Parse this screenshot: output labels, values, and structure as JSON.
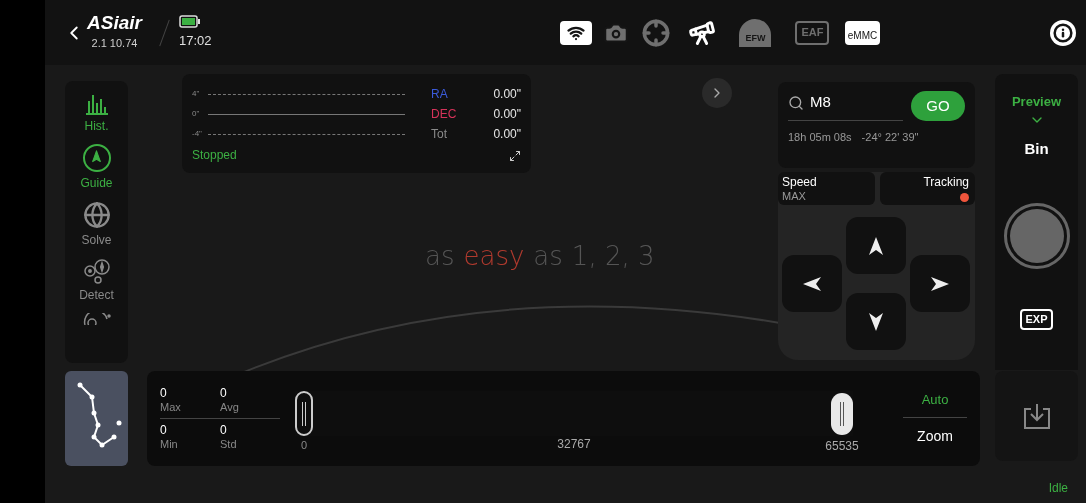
{
  "top_bar": {
    "app": {
      "logo": "ASiair",
      "version": "2.1 10.74"
    },
    "time": "17:02",
    "devices": [
      {
        "kind": "wifi",
        "active": true
      },
      {
        "kind": "camera",
        "active": false
      },
      {
        "kind": "target",
        "active": false
      },
      {
        "kind": "telescope",
        "active": true
      },
      {
        "kind": "efw",
        "label": "EFW",
        "active": false
      },
      {
        "kind": "eaf",
        "label": "EAF",
        "active": false
      },
      {
        "kind": "emmc",
        "label": "eMMC",
        "active": true
      }
    ]
  },
  "sidebar": {
    "items": [
      {
        "kind": "hist",
        "label": "Hist.",
        "active": true
      },
      {
        "kind": "guide",
        "label": "Guide",
        "active": true
      },
      {
        "kind": "solve",
        "label": "Solve",
        "active": false
      },
      {
        "kind": "detect",
        "label": "Detect",
        "active": false
      },
      {
        "kind": "more",
        "active": false
      }
    ]
  },
  "guide_panel": {
    "y_labels": [
      "4\"",
      "0\"",
      "-4\""
    ],
    "rows": [
      {
        "label": "RA",
        "value": "0.00\"",
        "color": "#3b5bdb"
      },
      {
        "label": "DEC",
        "value": "0.00\"",
        "color": "#d6335a"
      },
      {
        "label": "Tot",
        "value": "0.00\"",
        "color": "#8a8a8a"
      }
    ],
    "status": "Stopped"
  },
  "tagline": [
    {
      "text": "as",
      "highlight": false
    },
    {
      "text": "easy",
      "highlight": true
    },
    {
      "text": "as",
      "highlight": false
    },
    {
      "text": "1, 2, 3",
      "highlight": false
    }
  ],
  "goto": {
    "target": "M8",
    "button": "GO",
    "ra": "18h 05m 08s",
    "dec": "-24° 22' 39\""
  },
  "mount": {
    "speed_label": "Speed",
    "speed": "MAX",
    "tracking_label": "Tracking",
    "tracking_on": false
  },
  "capture": {
    "mode": "Preview",
    "bin": "Bin",
    "exp": "EXP",
    "status": "Idle"
  },
  "histogram": {
    "stats": [
      {
        "value": "0",
        "label": "Max"
      },
      {
        "value": "0",
        "label": "Avg"
      },
      {
        "value": "0",
        "label": "Min"
      },
      {
        "value": "0",
        "label": "Std"
      }
    ],
    "black_point": {
      "level": 0,
      "reading": "0"
    },
    "mid_reading": "32767",
    "white_point": {
      "level": 1,
      "reading": "65535"
    },
    "auto": "Auto",
    "zoom": "Zoom"
  }
}
